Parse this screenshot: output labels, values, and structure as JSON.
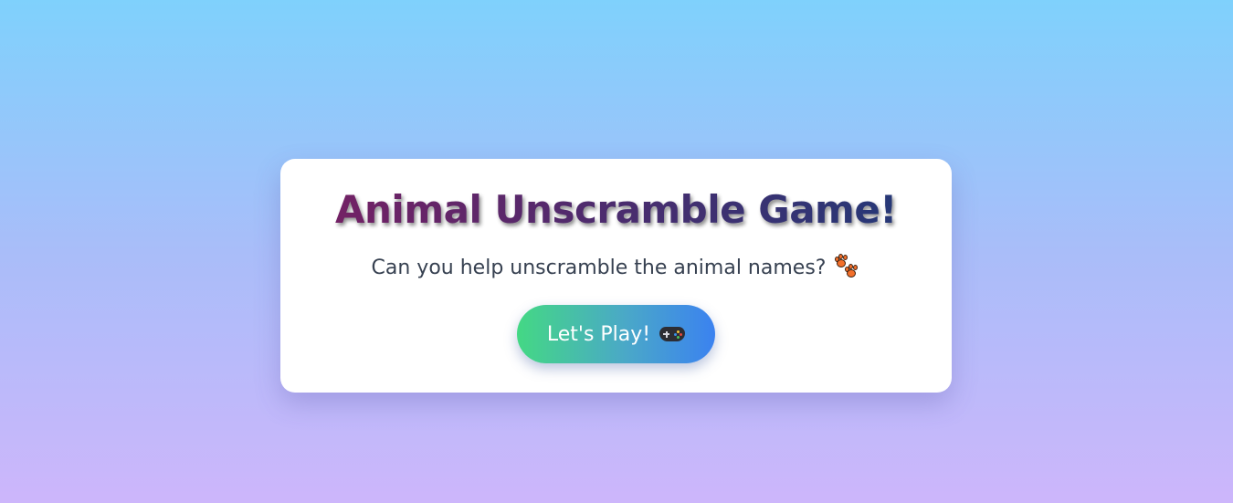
{
  "card": {
    "title": "Animal Unscramble Game!",
    "subtitle": "Can you help unscramble the animal names?",
    "subtitle_icon": "paw-prints-icon",
    "play_button": {
      "label": "Let's Play!",
      "icon": "gamepad-icon"
    }
  },
  "colors": {
    "background_top": "#7fd1fc",
    "background_bottom": "#cdb6fb",
    "title_start": "#7a1f63",
    "title_end": "#1f3a78",
    "button_start": "#44d884",
    "button_end": "#3b82f0",
    "paw": "#f36f2a"
  }
}
